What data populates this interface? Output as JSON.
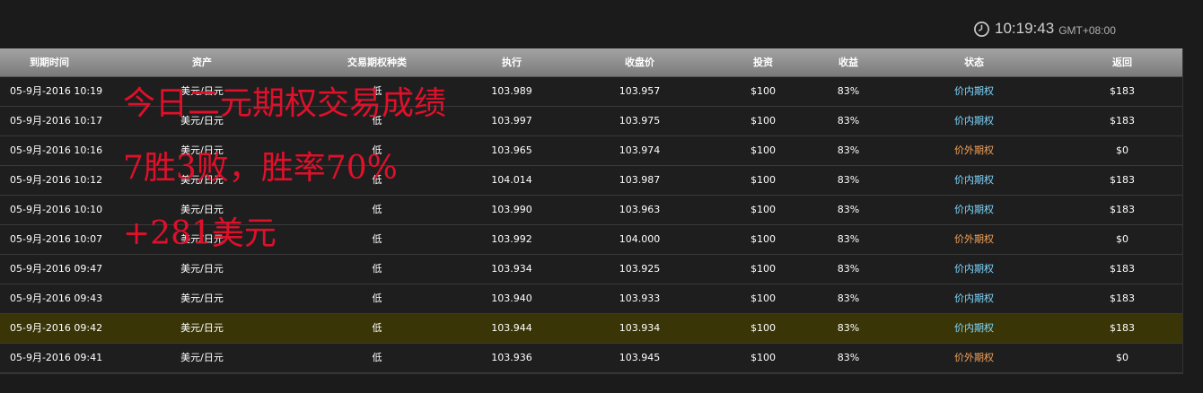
{
  "clock": {
    "time": "10:19:43",
    "timezone": "GMT+08:00",
    "icon": "clock-icon"
  },
  "table": {
    "headers": [
      "到期时间",
      "资产",
      "交易期权种类",
      "执行",
      "收盘价",
      "投资",
      "收益",
      "状态",
      "返回"
    ],
    "rows": [
      {
        "expiry": "05-9月-2016 10:19",
        "asset": "美元/日元",
        "type": "低",
        "strike": "103.989",
        "close": "103.957",
        "invest": "$100",
        "yield": "83%",
        "status": "价内期权",
        "return": "$183"
      },
      {
        "expiry": "05-9月-2016 10:17",
        "asset": "美元/日元",
        "type": "低",
        "strike": "103.997",
        "close": "103.975",
        "invest": "$100",
        "yield": "83%",
        "status": "价内期权",
        "return": "$183"
      },
      {
        "expiry": "05-9月-2016 10:16",
        "asset": "美元/日元",
        "type": "低",
        "strike": "103.965",
        "close": "103.974",
        "invest": "$100",
        "yield": "83%",
        "status": "价外期权",
        "return": "$0"
      },
      {
        "expiry": "05-9月-2016 10:12",
        "asset": "美元/日元",
        "type": "低",
        "strike": "104.014",
        "close": "103.987",
        "invest": "$100",
        "yield": "83%",
        "status": "价内期权",
        "return": "$183"
      },
      {
        "expiry": "05-9月-2016 10:10",
        "asset": "美元/日元",
        "type": "低",
        "strike": "103.990",
        "close": "103.963",
        "invest": "$100",
        "yield": "83%",
        "status": "价内期权",
        "return": "$183"
      },
      {
        "expiry": "05-9月-2016 10:07",
        "asset": "美元/日元",
        "type": "低",
        "strike": "103.992",
        "close": "104.000",
        "invest": "$100",
        "yield": "83%",
        "status": "价外期权",
        "return": "$0"
      },
      {
        "expiry": "05-9月-2016 09:47",
        "asset": "美元/日元",
        "type": "低",
        "strike": "103.934",
        "close": "103.925",
        "invest": "$100",
        "yield": "83%",
        "status": "价内期权",
        "return": "$183"
      },
      {
        "expiry": "05-9月-2016 09:43",
        "asset": "美元/日元",
        "type": "低",
        "strike": "103.940",
        "close": "103.933",
        "invest": "$100",
        "yield": "83%",
        "status": "价内期权",
        "return": "$183"
      },
      {
        "expiry": "05-9月-2016 09:42",
        "asset": "美元/日元",
        "type": "低",
        "strike": "103.944",
        "close": "103.934",
        "invest": "$100",
        "yield": "83%",
        "status": "价内期权",
        "return": "$183"
      },
      {
        "expiry": "05-9月-2016 09:41",
        "asset": "美元/日元",
        "type": "低",
        "strike": "103.936",
        "close": "103.945",
        "invest": "$100",
        "yield": "83%",
        "status": "价外期权",
        "return": "$0"
      }
    ],
    "highlighted_row": 8
  },
  "overlay": {
    "line1": "今日二元期权交易成绩",
    "line2": "7胜3败，胜率70%",
    "line3": "+281美元"
  },
  "colors": {
    "background": "#1b1b1b",
    "header_gradient_top": "#a3a3a3",
    "header_gradient_bottom": "#7a7a7a",
    "highlight_row": "#3a3507",
    "status_in_the_money": "#7fd8ff",
    "status_out_of_the_money": "#f5a35a",
    "overlay_text": "#e0102a"
  }
}
